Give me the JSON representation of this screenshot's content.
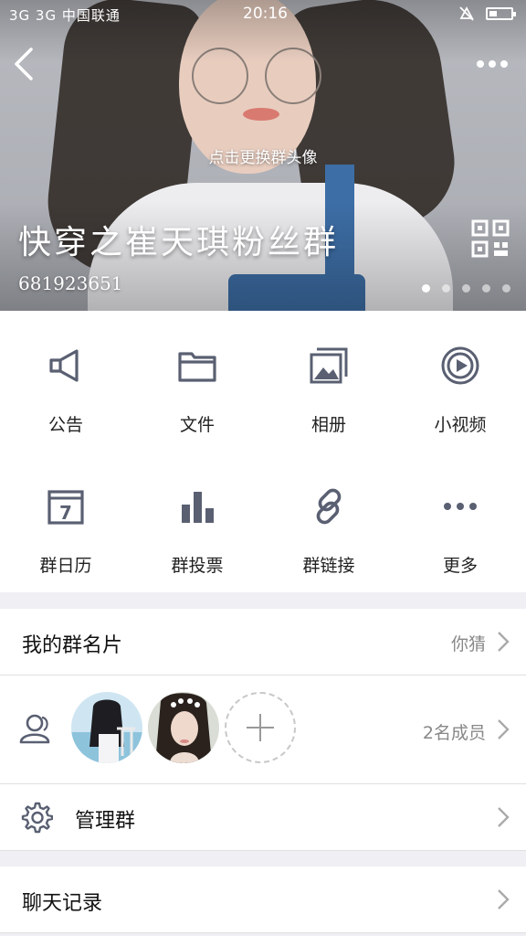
{
  "status_bar": {
    "carrier": "3G 3G 中国联通",
    "time": "20:16"
  },
  "header": {
    "change_avatar_text": "点击更换群头像",
    "group_name": "快穿之崔天琪粉丝群",
    "group_id": "681923651",
    "page_count": 5,
    "active_page": 1
  },
  "features": [
    {
      "label": "公告",
      "icon": "megaphone-icon"
    },
    {
      "label": "文件",
      "icon": "folder-icon"
    },
    {
      "label": "相册",
      "icon": "photo-album-icon"
    },
    {
      "label": "小视频",
      "icon": "video-play-icon"
    },
    {
      "label": "群日历",
      "icon": "calendar-icon",
      "day": "7"
    },
    {
      "label": "群投票",
      "icon": "bar-chart-icon"
    },
    {
      "label": "群链接",
      "icon": "link-icon"
    },
    {
      "label": "更多",
      "icon": "more-dots-icon"
    }
  ],
  "rows": {
    "card": {
      "title": "我的群名片",
      "value": "你猜"
    },
    "members": {
      "value": "2名成员"
    },
    "manage": {
      "title": "管理群"
    },
    "history": {
      "title": "聊天记录"
    }
  },
  "colors": {
    "icon": "#5a6072",
    "text": "#222222",
    "muted": "#888888",
    "background": "#efeff4"
  }
}
